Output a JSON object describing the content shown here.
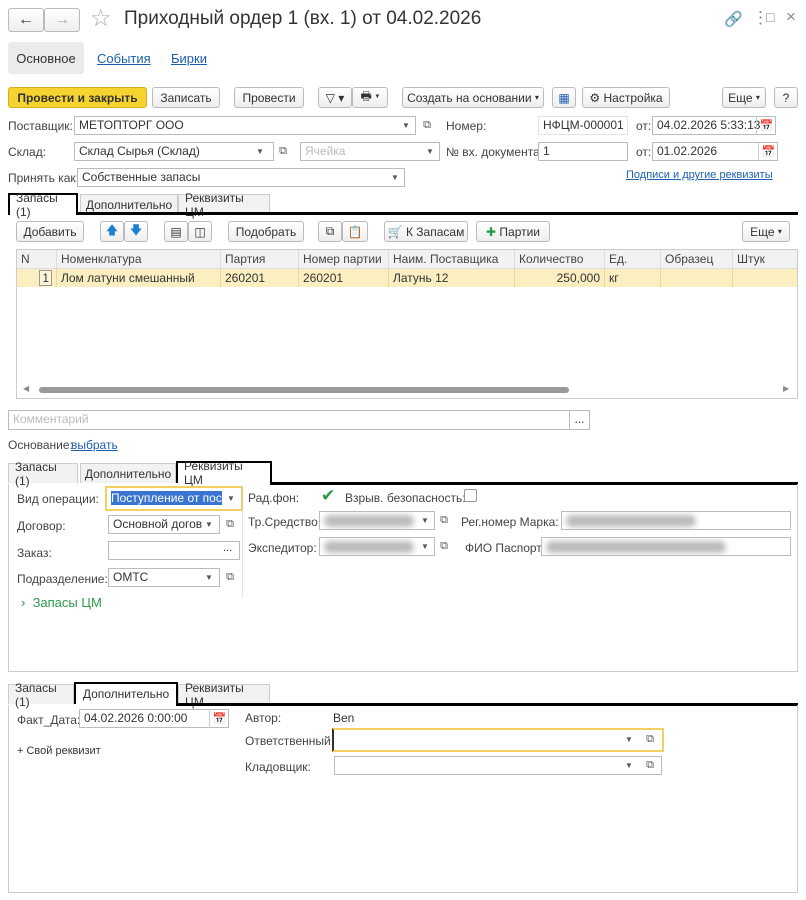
{
  "window": {
    "title": "Приходный ордер 1 (вх. 1) от 04.02.2026"
  },
  "nav_tabs": [
    "Основное",
    "События",
    "Бирки"
  ],
  "toolbar": {
    "post_close": "Провести и закрыть",
    "save": "Записать",
    "post": "Провести",
    "create_based": "Создать на основании",
    "settings": "Настройка",
    "more": "Еще",
    "help": "?"
  },
  "header": {
    "supplier_label": "Поставщик:",
    "supplier": "МЕТОПТОРГ ООО",
    "number_label": "Номер:",
    "number": "НФЦМ-000001",
    "from_label": "от:",
    "date": "04.02.2026  5:33:13",
    "warehouse_label": "Склад:",
    "warehouse": "Склад Сырья (Склад)",
    "cell_placeholder": "Ячейка",
    "in_doc_label": "№ вх. документа:",
    "in_doc": "1",
    "in_doc_date": "01.02.2026",
    "accept_as_label": "Принять как:",
    "accept_as": "Собственные запасы",
    "signatures_link": "Подписи и другие реквизиты"
  },
  "doc_tabs": [
    "Запасы (1)",
    "Дополнительно",
    "Реквизиты ЦМ"
  ],
  "table_toolbar": {
    "add": "Добавить",
    "pick": "Подобрать",
    "to_stock": "К Запасам",
    "batches": "Партии",
    "more": "Еще"
  },
  "table": {
    "columns": [
      "N",
      "Номенклатура",
      "Партия",
      "Номер партии",
      "Наим. Поставщика",
      "Количество",
      "Ед.",
      "Образец",
      "Штук"
    ],
    "rows": [
      [
        "1",
        "Лом латуни смешанный",
        "260201",
        "260201",
        "Латунь 12",
        "250,000",
        "кг",
        "",
        ""
      ]
    ]
  },
  "comment_placeholder": "Комментарий",
  "basis": {
    "label": "Основание:",
    "link": "выбрать"
  },
  "cm_panel": {
    "op_type_label": "Вид операции:",
    "op_type": "Поступление от пос",
    "contract_label": "Договор:",
    "contract": "Основной догов",
    "order_label": "Заказ:",
    "order": "",
    "division_label": "Подразделение:",
    "division": "ОМТС",
    "rad_label": "Рад.фон:",
    "rad_checked": true,
    "explosive_label": "Взрыв. безопасность:",
    "explosive_checked": false,
    "vehicle_label": "Тр.Средство:",
    "reg_label": "Рег.номер Марка:",
    "forwarder_label": "Экспедитор:",
    "passport_label": "ФИО Паспорт:",
    "stock_cm": "Запасы ЦМ"
  },
  "extra_panel": {
    "fact_date_label": "Факт_Дата:",
    "fact_date": "04.02.2026  0:00:00",
    "own_attr": "+ Свой реквизит",
    "author_label": "Автор:",
    "author": "Ben",
    "responsible_label": "Ответственный:",
    "responsible": "",
    "storekeeper_label": "Кладовщик:",
    "storekeeper": ""
  },
  "colors": {
    "accent": "#f7d330",
    "row_selected": "#fbefc2",
    "link": "#1c5fb0",
    "green": "#2a9a4a"
  }
}
